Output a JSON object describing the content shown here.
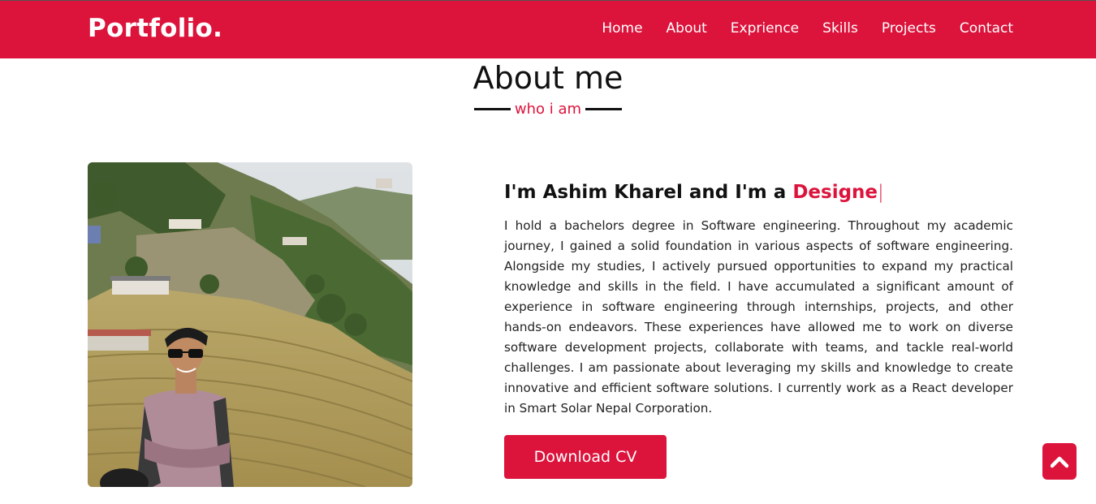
{
  "navbar": {
    "logo": "Portfolio.",
    "items": [
      {
        "label": "Home"
      },
      {
        "label": "About"
      },
      {
        "label": "Exprience"
      },
      {
        "label": "Skills"
      },
      {
        "label": "Projects"
      },
      {
        "label": "Contact"
      }
    ],
    "color": "#dc143c"
  },
  "about": {
    "title": "About me",
    "subtitle": "who i am",
    "heading_prefix": "I'm Ashim Kharel and I'm a ",
    "heading_typed": "Designe",
    "cursor": "|",
    "paragraph": "I hold a bachelors degree in Software engineering. Throughout my academic journey, I gained a solid foundation in various aspects of software engineering. Alongside my studies, I actively pursued opportunities to expand my practical knowledge and skills in the field. I have accumulated a significant amount of experience in software engineering through internships, projects, and other hands-on endeavors. These experiences have allowed me to work on diverse software development projects, collaborate with teams, and tackle real-world challenges. I am passionate about leveraging my skills and knowledge to create innovative and efficient software solutions. I currently work as a React developer in Smart Solar Nepal Corporation.",
    "button_label": "Download CV"
  },
  "icons": {
    "scroll_top": "chevron-up-icon"
  }
}
